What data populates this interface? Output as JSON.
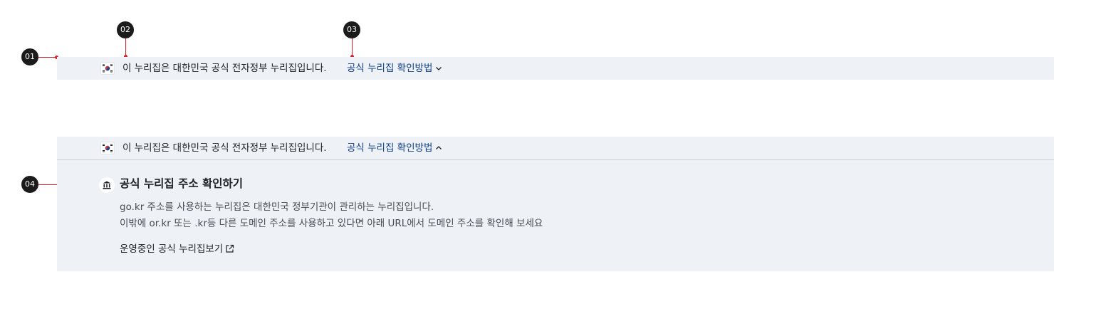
{
  "markers": [
    "01",
    "02",
    "03",
    "04"
  ],
  "banner": {
    "text": "이 누리집은 대한민국 공식 전자정부 누리집입니다.",
    "link_label": "공식 누리집 확인방법"
  },
  "expanded": {
    "text": "이 누리집은 대한민국 공식 전자정부 누리집입니다.",
    "link_label": "공식 누리집 확인방법",
    "title": "공식 누리집 주소 확인하기",
    "desc_line1": "go.kr 주소를 사용하는 누리집은 대한민국 정부기관이 관리하는 누리집입니다.",
    "desc_line2": "이밖에 or.kr 또는 .kr등 다른 도메인 주소를 사용하고 있다면 아래 URL에서 도메인 주소를 확인해 보세요",
    "official_sites_link": "운영중인 공식 누리집보기"
  },
  "icons": {
    "flag": "korea-flag-icon",
    "collapsed_chevron": "chevron-down-icon",
    "expanded_chevron": "chevron-up-icon",
    "building": "government-building-icon",
    "external": "external-link-icon"
  },
  "colors": {
    "banner_bg": "#eef2f7",
    "link": "#0f3f8a",
    "marker_line": "#d7202c",
    "marker_bg": "#1b1b1b"
  }
}
